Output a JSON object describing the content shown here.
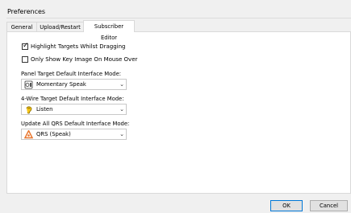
{
  "window": {
    "title": "Preferences"
  },
  "tabs": [
    {
      "label": "General"
    },
    {
      "label": "Upload/Restart"
    },
    {
      "label": "Subscriber Editor"
    }
  ],
  "options": {
    "highlight_targets": {
      "label": "Highlight Targets Whilst Dragging",
      "checked": true
    },
    "key_image_mouse_over": {
      "label": "Only Show Key Image On Mouse Over",
      "checked": false
    }
  },
  "panel_target": {
    "label": "Panel Target Default Interface Mode:",
    "value": "Momentary Speak",
    "icon": "speaker-panel-icon"
  },
  "fourwire_target": {
    "label": "4-Wire Target Default Interface Mode:",
    "value": "Listen",
    "icon": "listen-ear-icon"
  },
  "qrs": {
    "label": "Update All QRS Default Interface Mode:",
    "value": "QRS (Speak)",
    "icon": "qrs-speak-icon"
  },
  "buttons": {
    "ok": "OK",
    "cancel": "Cancel"
  },
  "colors": {
    "accent": "#0078d7",
    "listen_icon": "#f5c518",
    "qrs_icon": "#e8742a"
  }
}
